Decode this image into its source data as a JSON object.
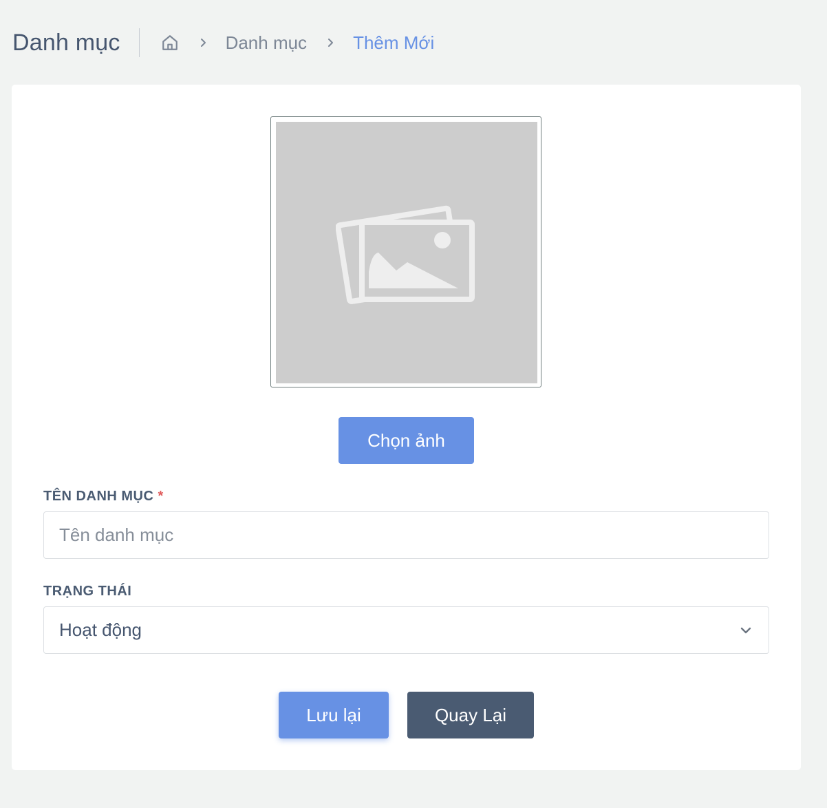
{
  "header": {
    "title": "Danh mục",
    "breadcrumb": {
      "home_icon": "home-icon",
      "items": [
        "Danh mục",
        "Thêm Mới"
      ]
    }
  },
  "form": {
    "image": {
      "placeholder_icon": "image-placeholder-icon",
      "choose_label": "Chọn ảnh"
    },
    "name_field": {
      "label": "TÊN DANH MỤC",
      "required_mark": "*",
      "value": "",
      "placeholder": "Tên danh mục"
    },
    "status_field": {
      "label": "TRẠNG THÁI",
      "selected": "Hoạt động"
    },
    "actions": {
      "save_label": "Lưu lại",
      "back_label": "Quay Lại"
    }
  },
  "colors": {
    "primary": "#6791e4",
    "secondary": "#4a5b72",
    "required": "#e05a5a",
    "background": "#f1f3f2"
  }
}
